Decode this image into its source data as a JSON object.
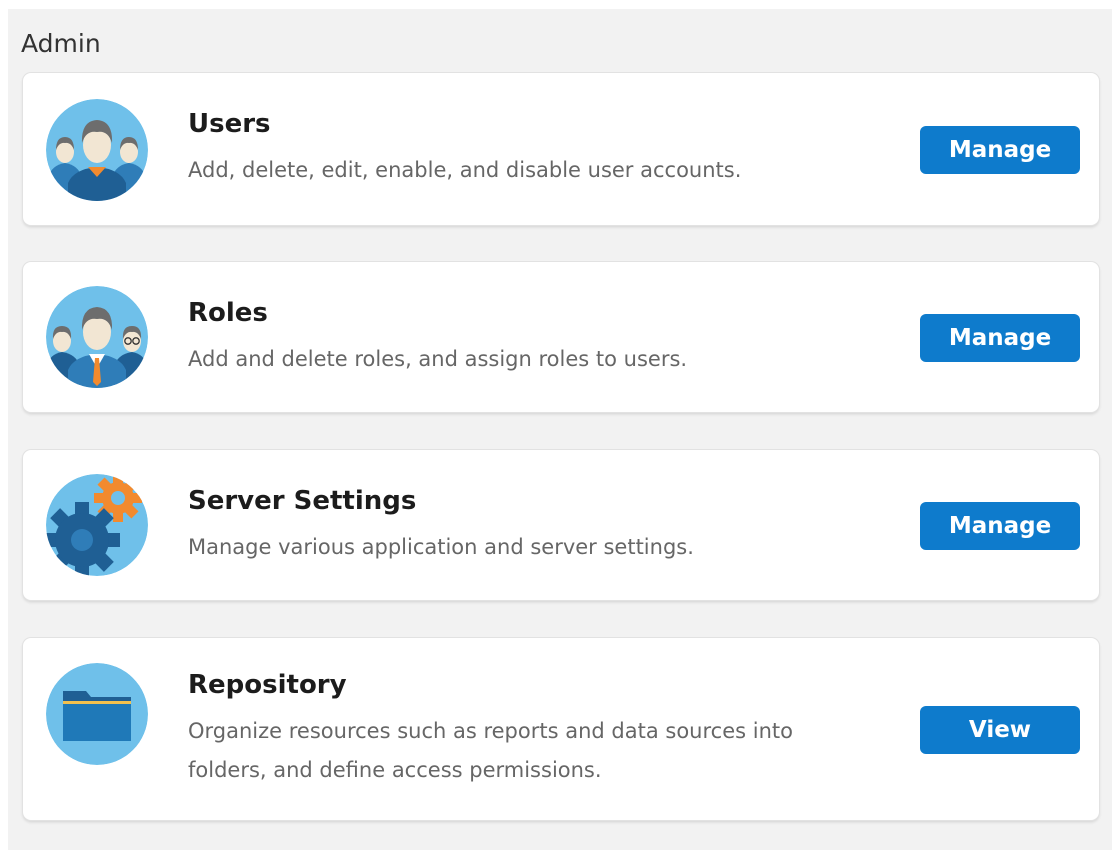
{
  "page": {
    "title": "Admin"
  },
  "cards": [
    {
      "icon": "users-icon",
      "name": "Users",
      "description": "Add, delete, edit, enable, and disable user accounts.",
      "button": "Manage"
    },
    {
      "icon": "roles-icon",
      "name": "Roles",
      "description": "Add and delete roles, and assign roles to users.",
      "button": "Manage"
    },
    {
      "icon": "gears-icon",
      "name": "Server Settings",
      "description": "Manage various application and server settings.",
      "button": "Manage"
    },
    {
      "icon": "folder-icon",
      "name": "Repository",
      "description": "Organize resources such as reports and data sources into folders, and define access permissions.",
      "button": "View"
    }
  ],
  "colors": {
    "panel_bg": "#f2f2f2",
    "button_bg": "#0e7bcc",
    "icon_circle": "#6fc0ea",
    "icon_dark_blue": "#1f5f94",
    "icon_orange": "#f28a2e"
  }
}
